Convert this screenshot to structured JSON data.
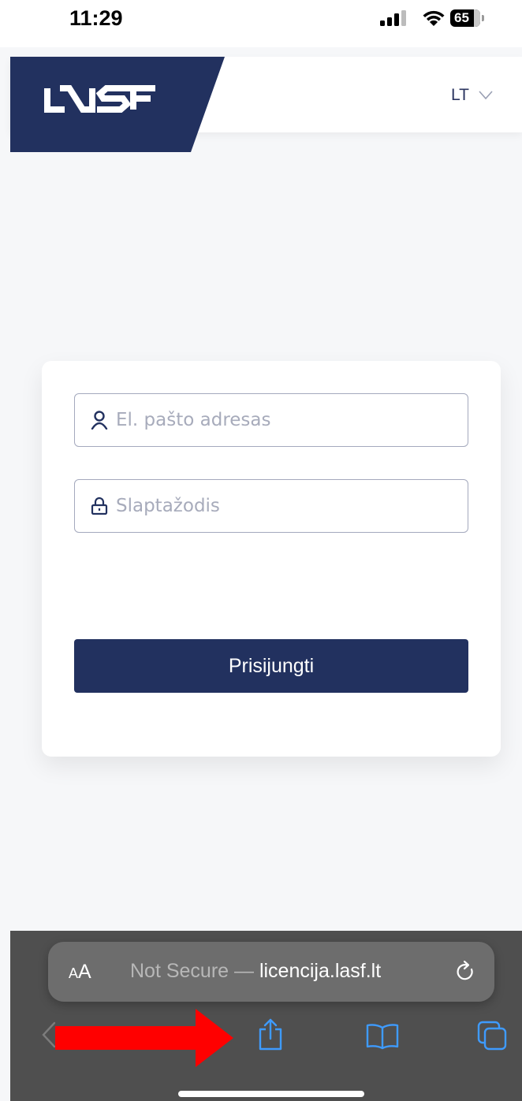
{
  "status_bar": {
    "time": "11:29",
    "battery": "65",
    "icons": [
      "signal-icon",
      "wifi-icon",
      "battery-icon"
    ]
  },
  "header": {
    "logo_text": "LASF",
    "language": "LT",
    "language_icon": "chevron-down-icon",
    "brand_color": "#22315f"
  },
  "login": {
    "email_placeholder": "El. pašto adresas",
    "email_icon": "user-icon",
    "password_placeholder": "Slaptažodis",
    "password_icon": "lock-icon",
    "submit_label": "Prisijungti"
  },
  "browser": {
    "aa_label_small": "A",
    "aa_label_large": "A",
    "security_label": "Not Secure — ",
    "domain": "licencija.lasf.lt",
    "toolbar_icons": [
      "back-icon",
      "share-icon",
      "bookmarks-icon",
      "tabs-icon",
      "reload-icon"
    ],
    "accent_color": "#3e9bff"
  },
  "annotation": {
    "type": "arrow",
    "color": "#ff0000",
    "points_to": "share-icon"
  }
}
